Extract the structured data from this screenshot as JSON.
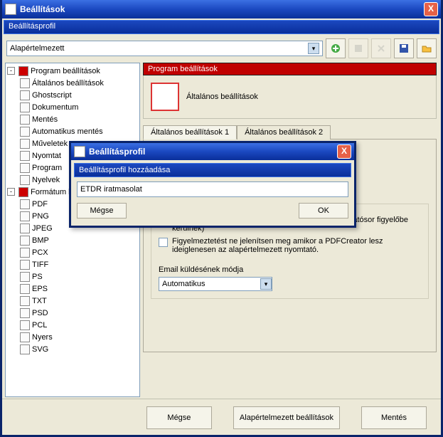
{
  "window": {
    "title": "Beállítások",
    "subtitle": "Beállításprofil",
    "close_label": "X"
  },
  "profile_bar": {
    "selected": "Alapértelmezett"
  },
  "tree": {
    "group1": {
      "label": "Program beállítások",
      "items": [
        "Általános beállítások",
        "Ghostscript",
        "Dokumentum",
        "Mentés",
        "Automatikus mentés",
        "Műveletek",
        "Nyomtat",
        "Program",
        "Nyelvek"
      ]
    },
    "group2": {
      "label": "Formátum be",
      "items": [
        "PDF",
        "PNG",
        "JPEG",
        "BMP",
        "PCX",
        "TIFF",
        "PS",
        "EPS",
        "TXT",
        "PSD",
        "PCL",
        "Nyers",
        "SVG"
      ]
    }
  },
  "right": {
    "section_title": "Program beállítások",
    "section_subtitle": "Általános beállítások",
    "tabs": [
      "Általános beállítások 1",
      "Általános beállítások 2"
    ],
    "partial_label": "Általános beállítások 1",
    "chk1": "Nyomtatás felfüggesztése (Dokumentumok a Nyomtatósor figyelőbe kerülnek)",
    "chk2": "Figyelmeztetést ne jelenítsen meg amikor a PDFCreator lesz ideiglenesen az alapértelmezett nyomtató.",
    "email_label": "Email küldésének módja",
    "email_value": "Automatikus"
  },
  "bottom": {
    "cancel": "Mégse",
    "defaults": "Alapértelmezett beállítások",
    "save": "Mentés"
  },
  "modal": {
    "title": "Beállításprofil",
    "sub": "Beállításprofil hozzáadása",
    "input_value": "ETDR iratmasolat",
    "cancel": "Mégse",
    "ok": "OK",
    "close_label": "X"
  }
}
